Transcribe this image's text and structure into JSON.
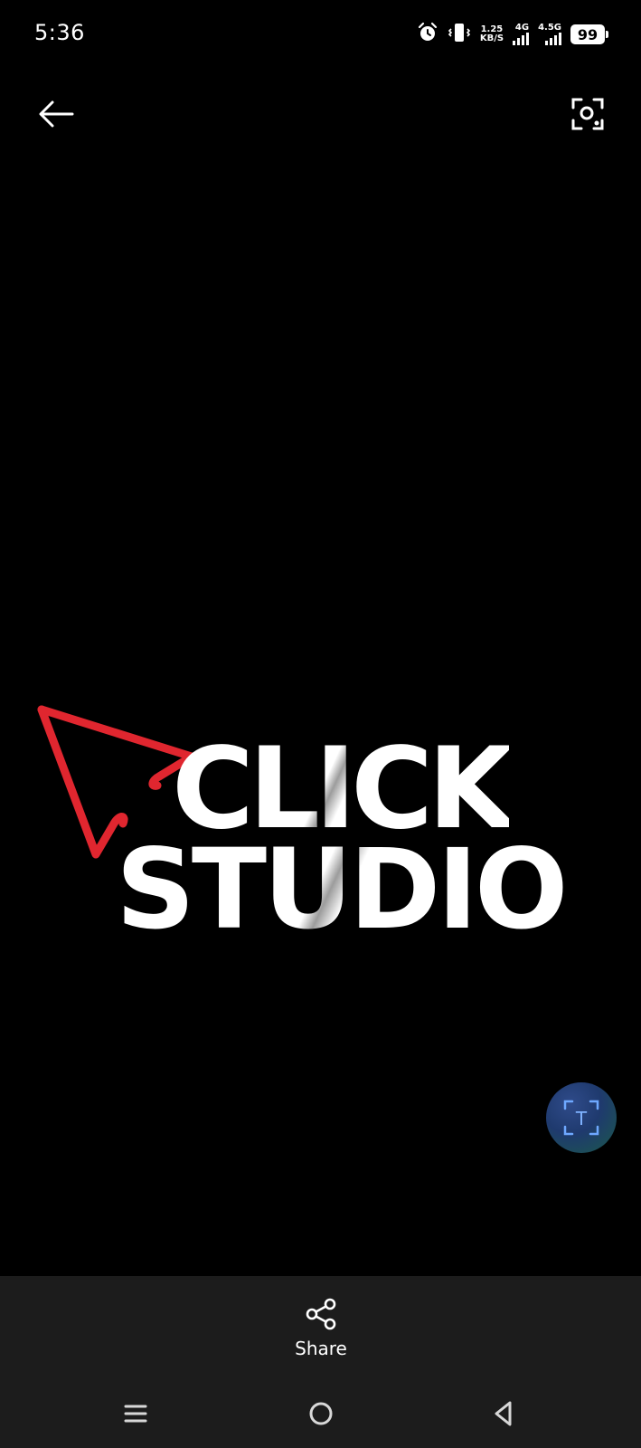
{
  "status_bar": {
    "time": "5:36",
    "alarm_icon": "alarm-icon",
    "vibrate_icon": "vibrate-icon",
    "net_speed_value": "1.25",
    "net_speed_unit": "KB/S",
    "sim1_label": "4G",
    "sim2_label": "4.5G",
    "battery": "99"
  },
  "toolbar": {
    "back_icon": "arrow-left-icon",
    "lens_icon": "lens-scan-icon"
  },
  "image": {
    "logo_line1": "CLICK",
    "logo_line2": "STUDIO",
    "accent_color": "#e0262f"
  },
  "fab": {
    "icon": "text-scan-icon",
    "letter": "T"
  },
  "actions": {
    "share_label": "Share",
    "share_icon": "share-icon"
  },
  "nav": {
    "menu_icon": "menu-icon",
    "home_icon": "home-icon",
    "back_icon": "back-triangle-icon"
  }
}
